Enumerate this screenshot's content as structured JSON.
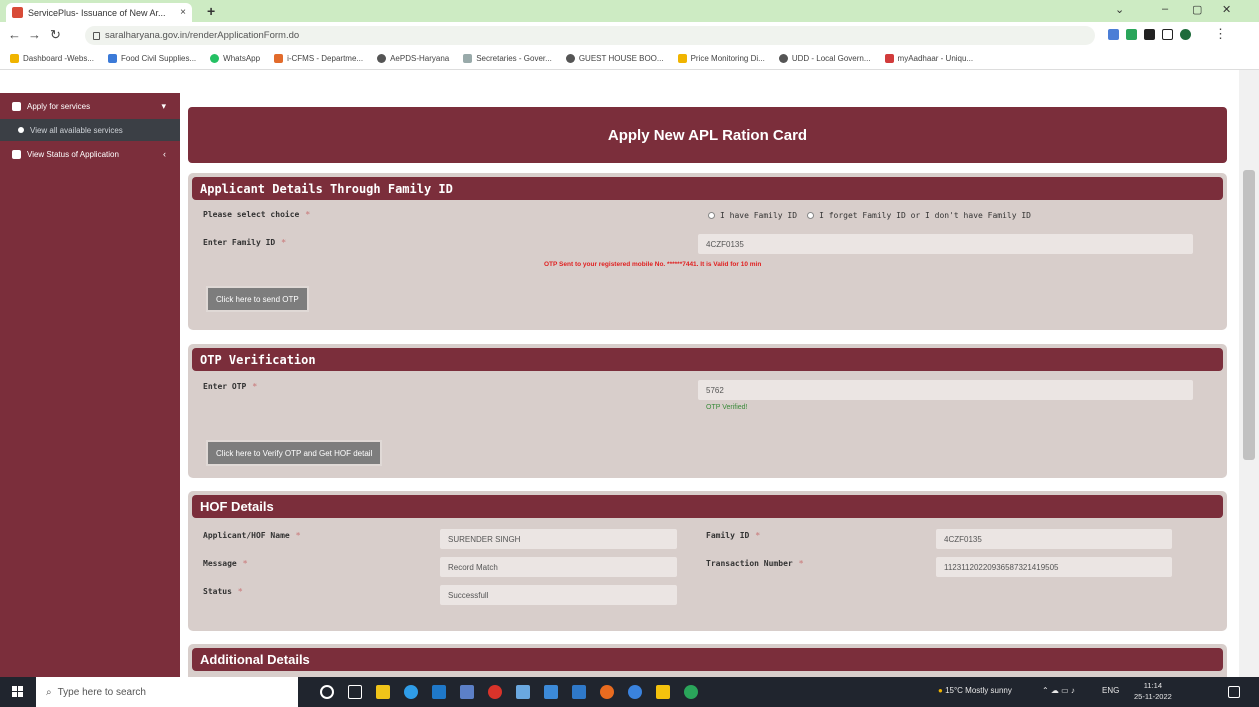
{
  "browser": {
    "tab_title": "ServicePlus- Issuance of New Ar...",
    "tab_close": "×",
    "new_tab": "+",
    "url": "saralharyana.gov.in/renderApplicationForm.do",
    "controls": {
      "minimize": "–",
      "restore": "▢",
      "close": "✕"
    },
    "bookmarks": [
      "Dashboard -Webs...",
      "Food Civil Supplies...",
      "WhatsApp",
      "i-CFMS - Departme...",
      "AePDS-Haryana",
      "Secretaries - Gover...",
      "GUEST HOUSE BOO...",
      "Price Monitoring Di...",
      "UDD - Local Govern...",
      "myAadhaar - Uniqu..."
    ]
  },
  "sidebar": {
    "items": [
      {
        "label": "Apply for services"
      },
      {
        "label": "View all available services"
      },
      {
        "label": "View Status of Application"
      }
    ]
  },
  "main": {
    "page_title": "Apply New APL Ration Card",
    "family_section": {
      "title": "Applicant Details Through Family ID",
      "choice_label": "Please select choice",
      "option_1": "I have Family ID",
      "option_2": "I forget Family ID or I don't have Family ID",
      "family_id_label": "Enter Family ID",
      "family_id_value": "4CZF0135",
      "otp_message": "OTP Sent to your registered mobile No. ******7441. It is Valid for 10 min",
      "send_otp_button": "Click here to send OTP"
    },
    "otp_section": {
      "title": "OTP Verification",
      "otp_label": "Enter OTP",
      "otp_value": "5762",
      "otp_status": "OTP Verified!",
      "verify_button": "Click here to Verify OTP and Get HOF detail"
    },
    "hof_section": {
      "title": "HOF Details",
      "applicant_label": "Applicant/HOF Name",
      "applicant_value": "SURENDER SINGH",
      "family_id_label": "Family ID",
      "family_id_value": "4CZF0135",
      "message_label": "Message",
      "message_value": "Record Match",
      "txn_label": "Transaction Number",
      "txn_value": "11231120220936587321419505",
      "status_label": "Status",
      "status_value": "Successfull"
    },
    "additional_section": {
      "title": "Additional Details"
    },
    "required_marker": "*"
  },
  "taskbar": {
    "search_placeholder": "Type here to search",
    "weather": "15°C  Mostly sunny",
    "language": "ENG",
    "time": "11:14",
    "date": "25-11-2022"
  },
  "colors": {
    "brand": "#7b2e3b",
    "panel": "#d8cecb",
    "button": "#7d7d7d",
    "error": "#e02020",
    "success": "#3a8a3a"
  }
}
